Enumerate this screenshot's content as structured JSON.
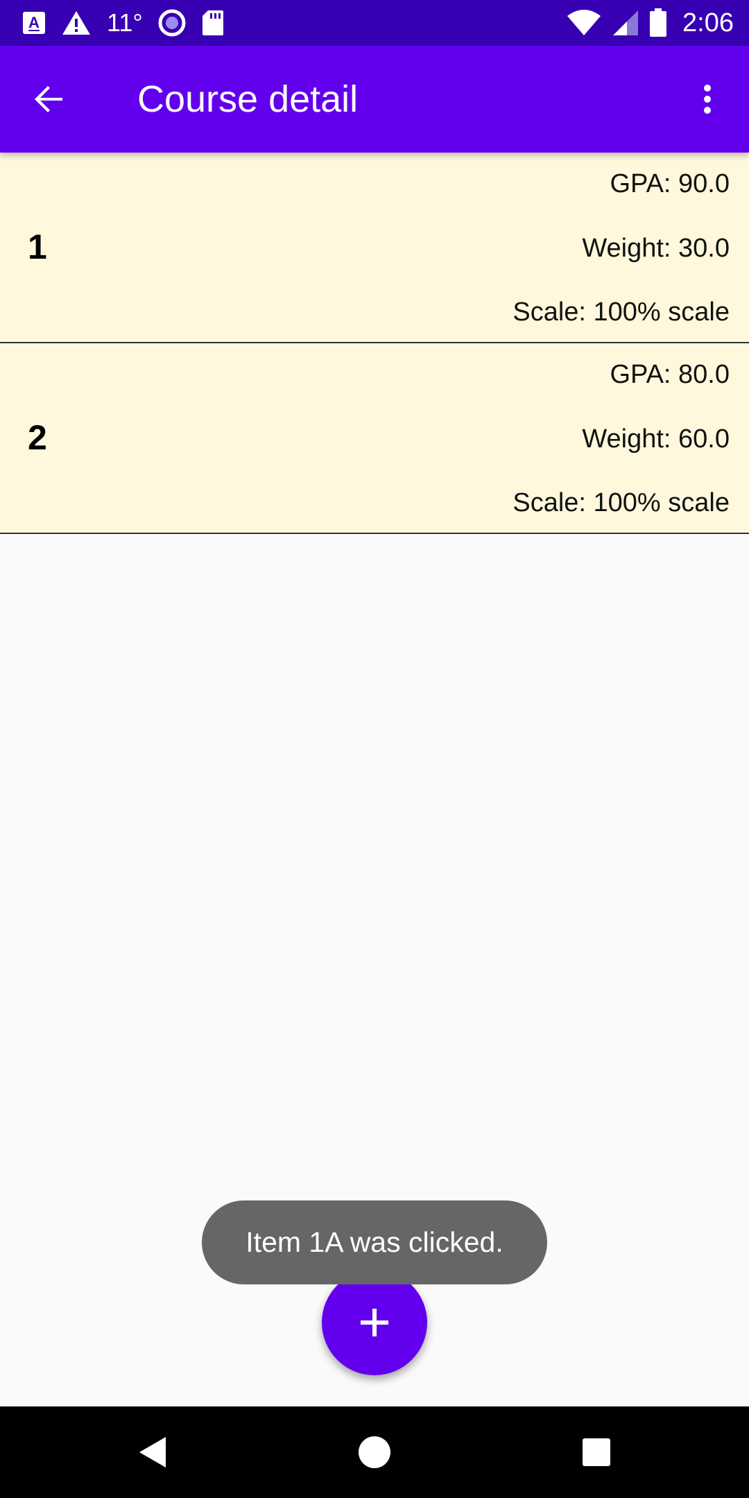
{
  "status_bar": {
    "temperature": "11°",
    "clock": "2:06",
    "icons": [
      "accessibility-a-icon",
      "warning-icon",
      "record-circle-icon",
      "sd-card-icon",
      "wifi-icon",
      "cellular-signal-icon",
      "battery-icon"
    ]
  },
  "app_bar": {
    "title": "Course detail",
    "back_icon": "arrow-back-icon",
    "menu_icon": "more-vert-icon"
  },
  "items": [
    {
      "name": "1",
      "gpa": "GPA: 90.0",
      "weight": "Weight: 30.0",
      "scale": "Scale: 100% scale"
    },
    {
      "name": "2",
      "gpa": "GPA: 80.0",
      "weight": "Weight: 60.0",
      "scale": "Scale: 100% scale"
    }
  ],
  "toast": {
    "message": "Item 1A was clicked."
  },
  "fab": {
    "icon": "plus-icon"
  },
  "nav_bar": {
    "icons": [
      "back-triangle-icon",
      "home-circle-icon",
      "recents-square-icon"
    ]
  },
  "colors": {
    "status_bar": "#3700b3",
    "app_bar": "#6200ee",
    "item_background": "#fff8dc",
    "page_background": "#fafafa",
    "toast_background": "#666666",
    "nav_bar": "#000000"
  }
}
